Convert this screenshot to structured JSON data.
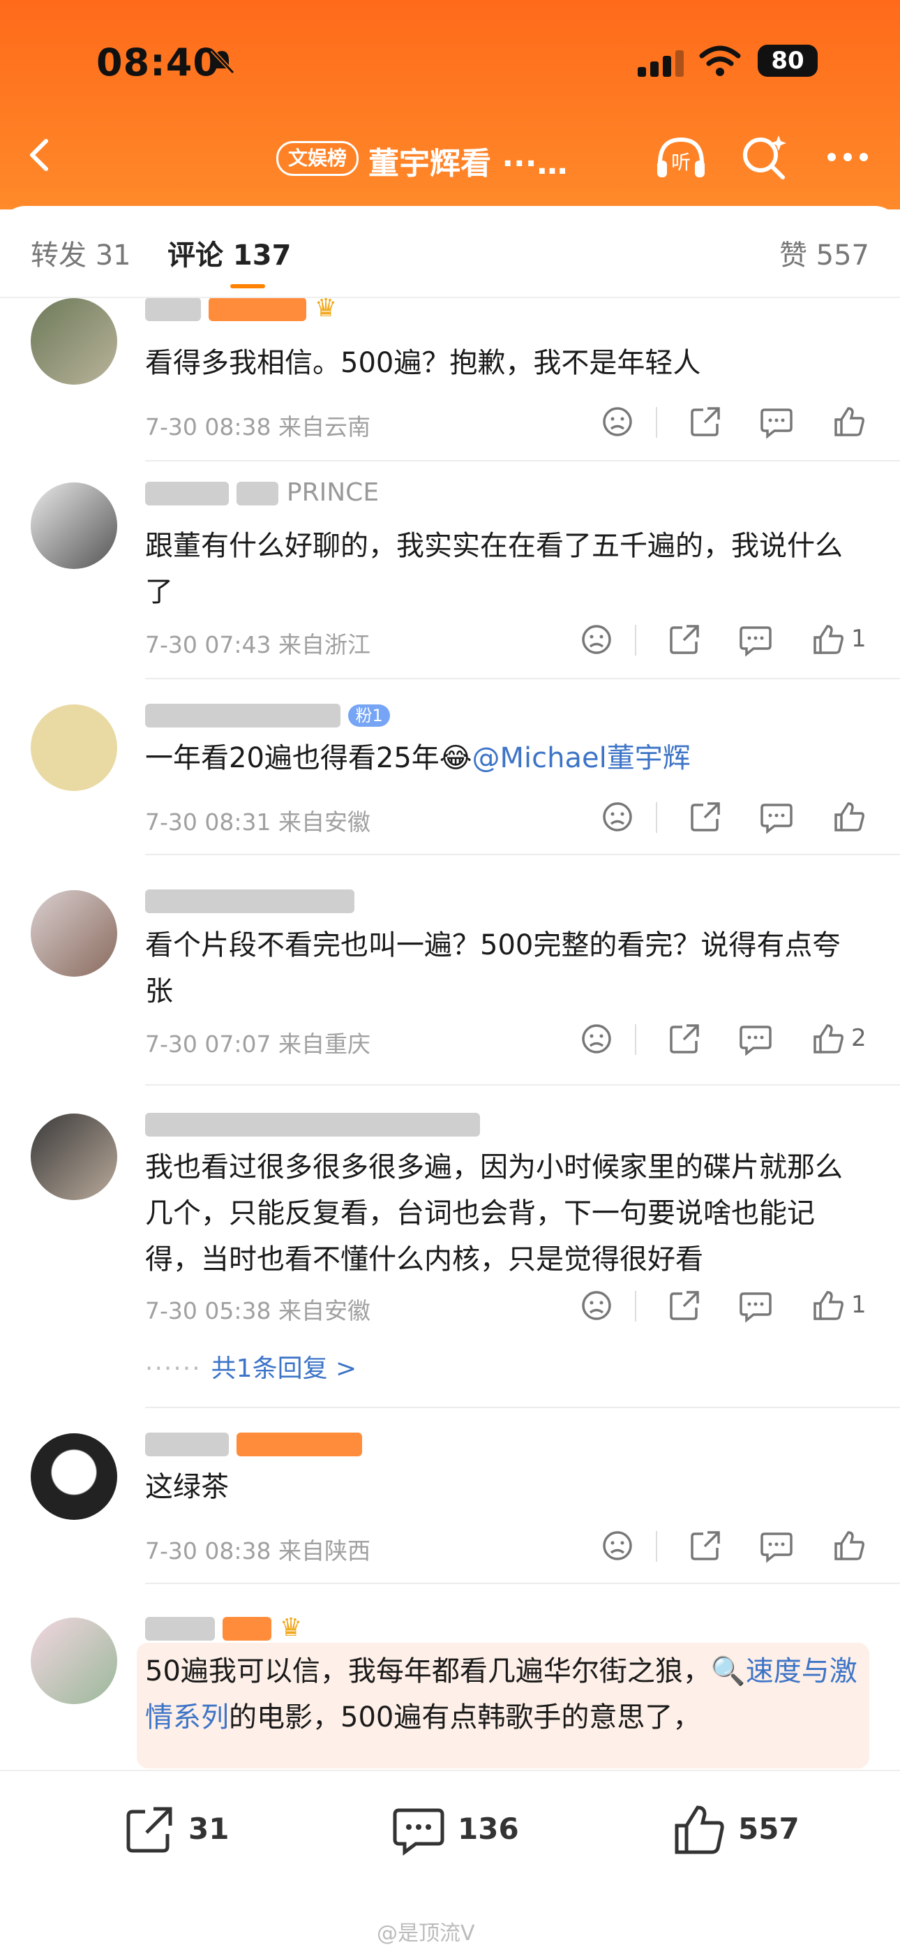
{
  "status_bar": {
    "time": "08:40",
    "battery": "80"
  },
  "nav": {
    "category_badge": "文娱榜",
    "title": "董宇辉看 ···…"
  },
  "tabs": {
    "repost": "转发 31",
    "comments": "评论 137",
    "likes": "赞 557"
  },
  "comments": [
    {
      "username": "",
      "text": "看得多我相信。500遍？抱歉，我不是年轻人",
      "time": "7-30 08:38",
      "location": "来自云南",
      "likes": ""
    },
    {
      "username": "PRINCE",
      "text": "跟董有什么好聊的，我实实在在看了五千遍的，我说什么了",
      "time": "7-30 07:43",
      "location": "来自浙江",
      "likes": "1"
    },
    {
      "username": "",
      "fan_badge": "粉1",
      "text": "一年看20遍也得看25年",
      "mention": "@Michael董宇辉",
      "time": "7-30 08:31",
      "location": "来自安徽",
      "likes": ""
    },
    {
      "username": "",
      "text": "看个片段不看完也叫一遍？500完整的看完？说得有点夸张",
      "time": "7-30 07:07",
      "location": "来自重庆",
      "likes": "2"
    },
    {
      "username": "",
      "text": "我也看过很多很多很多遍，因为小时候家里的碟片就那么几个，只能反复看，台词也会背，下一句要说啥也能记得，当时也看不懂什么内核，只是觉得很好看",
      "time": "7-30 05:38",
      "location": "来自安徽",
      "likes": "1",
      "replies": "共1条回复 >"
    },
    {
      "username": "",
      "text": "这绿茶",
      "time": "7-30 08:38",
      "location": "来自陕西",
      "likes": ""
    },
    {
      "username": "",
      "text_before": "50遍我可以信，我每年都看几遍华尔街之狼，",
      "search_link": "速度与激情系列",
      "text_after": "的电影，500遍有点韩歌手的意思了，"
    }
  ],
  "bottom_bar": {
    "reposts": "31",
    "comments": "136",
    "likes": "557"
  },
  "watermark": "@是顶流V",
  "colors": {
    "header": "#ff7a20",
    "accent": "#ff8200",
    "link": "#3d74c7"
  }
}
